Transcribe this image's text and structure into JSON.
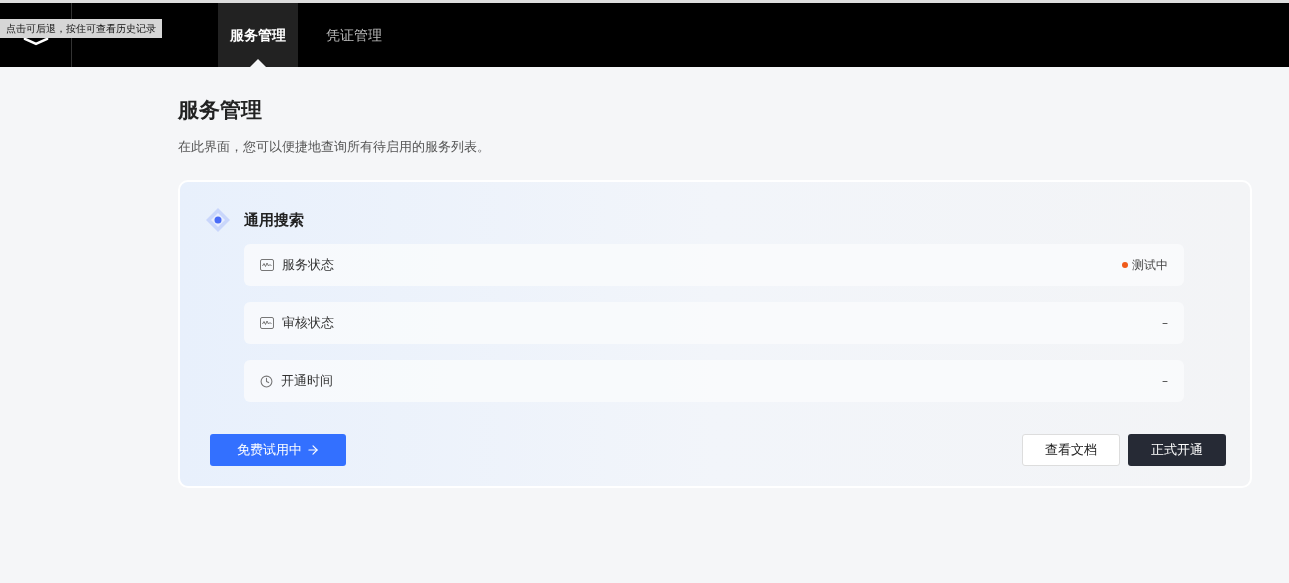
{
  "nav": {
    "tabs": [
      {
        "label": "服务管理",
        "selected": true
      },
      {
        "label": "凭证管理",
        "selected": false
      }
    ]
  },
  "tooltip": "点击可后退，按住可查看历史记录",
  "page": {
    "title": "服务管理",
    "description": "在此界面，您可以便捷地查询所有待启用的服务列表。"
  },
  "card": {
    "title": "通用搜索",
    "rows": [
      {
        "kind": "status",
        "label": "服务状态",
        "value": "测试中",
        "color": "#f05a1a"
      },
      {
        "kind": "status",
        "label": "审核状态",
        "value": "–"
      },
      {
        "kind": "time",
        "label": "开通时间",
        "value": "–"
      }
    ],
    "trial_button": "免费试用中",
    "doc_button": "查看文档",
    "activate_button": "正式开通"
  }
}
